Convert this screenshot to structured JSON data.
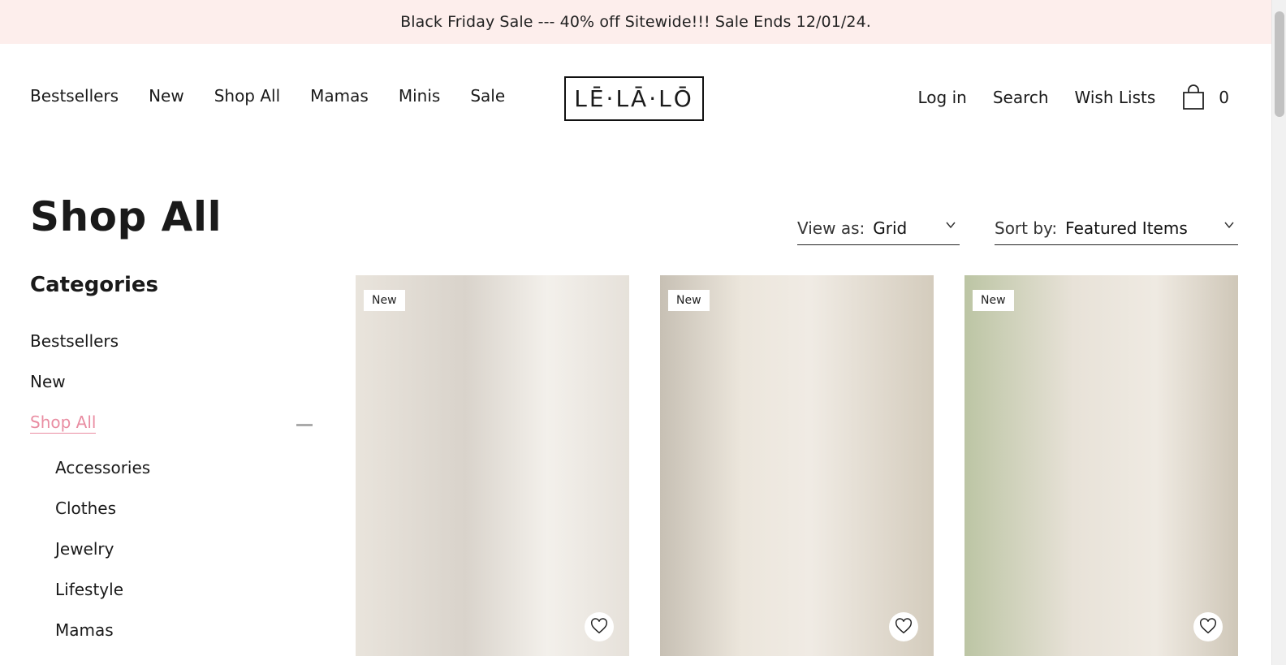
{
  "announcement": "Black Friday Sale --- 40% off Sitewide!!! Sale Ends 12/01/24.",
  "nav": {
    "left": [
      "Bestsellers",
      "New",
      "Shop All",
      "Mamas",
      "Minis",
      "Sale"
    ],
    "logo": "LĒ·LĀ·LŌ",
    "login": "Log in",
    "search": "Search",
    "wishlists": "Wish Lists",
    "cart_count": "0"
  },
  "page_title": "Shop All",
  "view": {
    "label": "View as:",
    "value": "Grid"
  },
  "sort": {
    "label": "Sort by:",
    "value": "Featured Items"
  },
  "categories": {
    "title": "Categories",
    "items": [
      "Bestsellers",
      "New",
      "Shop All"
    ],
    "active": "Shop All",
    "sub": [
      "Accessories",
      "Clothes",
      "Jewelry",
      "Lifestyle",
      "Mamas"
    ]
  },
  "products": [
    {
      "badge": "New"
    },
    {
      "badge": "New"
    },
    {
      "badge": "New"
    }
  ]
}
